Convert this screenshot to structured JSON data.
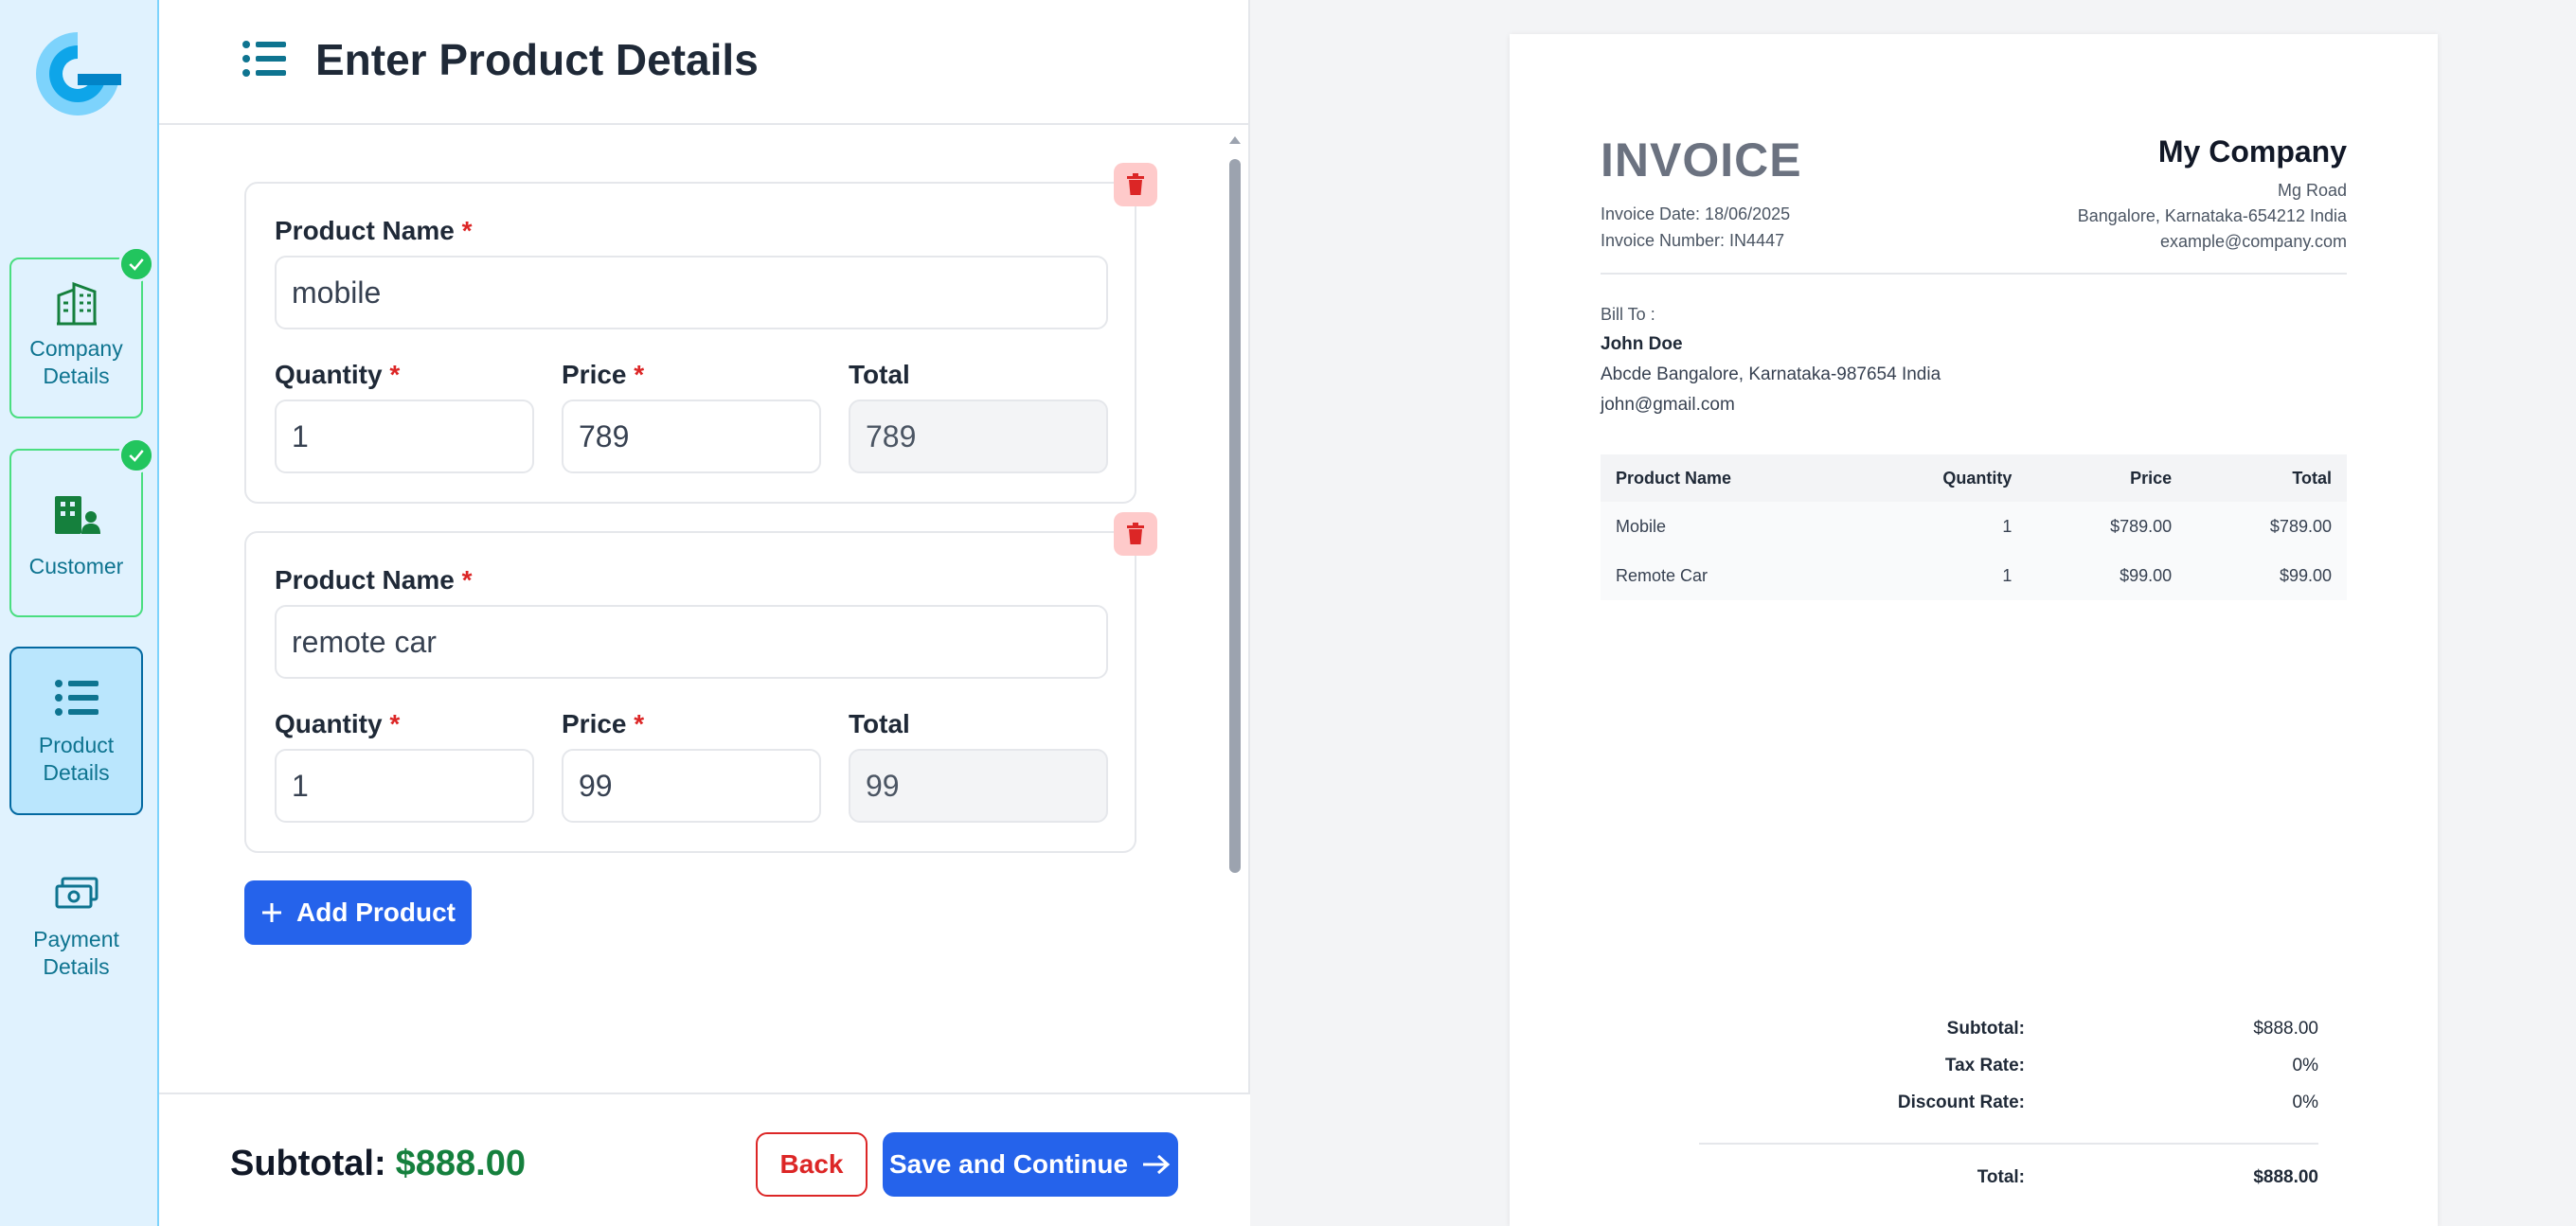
{
  "sidebar": {
    "steps": [
      {
        "label_line1": "Company",
        "label_line2": "Details",
        "status": "done",
        "icon": "building-icon"
      },
      {
        "label_line1": "Customer",
        "label_line2": "",
        "status": "done",
        "icon": "customer-icon"
      },
      {
        "label_line1": "Product",
        "label_line2": "Details",
        "status": "active",
        "icon": "list-icon"
      },
      {
        "label_line1": "Payment",
        "label_line2": "Details",
        "status": "pending",
        "icon": "money-icon"
      }
    ]
  },
  "form": {
    "title": "Enter Product Details",
    "required_mark": "*",
    "labels": {
      "product_name": "Product Name",
      "quantity": "Quantity",
      "price": "Price",
      "total": "Total"
    },
    "products": [
      {
        "name": "mobile",
        "quantity": "1",
        "price": "789",
        "total": "789"
      },
      {
        "name": "remote car",
        "quantity": "1",
        "price": "99",
        "total": "99"
      }
    ],
    "add_product_label": "Add Product",
    "subtotal_label": "Subtotal:",
    "subtotal_value": "$888.00",
    "back_label": "Back",
    "save_label": "Save and Continue"
  },
  "invoice": {
    "title": "INVOICE",
    "date_line": "Invoice Date: 18/06/2025",
    "number_line": "Invoice Number: IN4447",
    "company": {
      "name": "My Company",
      "address1": "Mg Road",
      "address2": "Bangalore, Karnataka-654212 India",
      "email": "example@company.com"
    },
    "bill_to": {
      "label": "Bill To :",
      "name": "John Doe",
      "address": "Abcde Bangalore, Karnataka-987654 India",
      "email": "john@gmail.com"
    },
    "table": {
      "headers": [
        "Product Name",
        "Quantity",
        "Price",
        "Total"
      ],
      "rows": [
        [
          "Mobile",
          "1",
          "$789.00",
          "$789.00"
        ],
        [
          "Remote Car",
          "1",
          "$99.00",
          "$99.00"
        ]
      ]
    },
    "totals": {
      "subtotal_label": "Subtotal:",
      "subtotal": "$888.00",
      "tax_label": "Tax Rate:",
      "tax": "0%",
      "discount_label": "Discount Rate:",
      "discount": "0%",
      "total_label": "Total:",
      "total": "$888.00"
    }
  },
  "colors": {
    "primary": "#2563eb",
    "success": "#22c55e",
    "danger": "#dc2626",
    "sidebar_bg": "#e0f2fe"
  }
}
